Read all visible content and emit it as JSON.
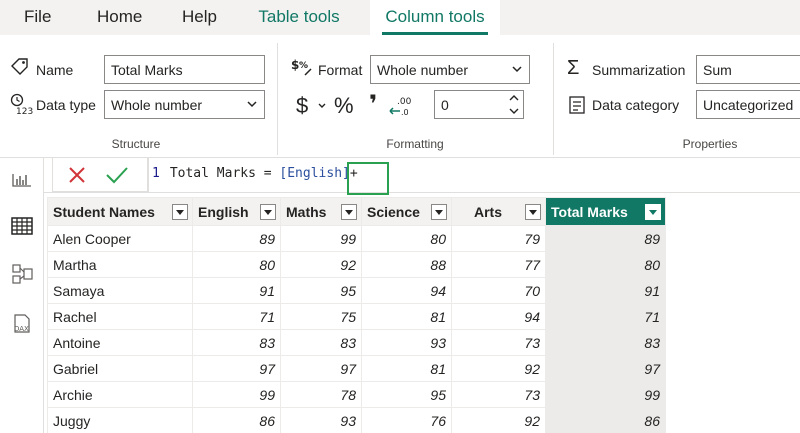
{
  "menu": {
    "tabs": [
      {
        "label": "File"
      },
      {
        "label": "Home"
      },
      {
        "label": "Help"
      },
      {
        "label": "Table tools"
      },
      {
        "label": "Column tools"
      }
    ],
    "accent": "#117865"
  },
  "ribbon": {
    "structure": {
      "name_label": "Name",
      "name_value": "Total Marks",
      "datatype_label": "Data type",
      "datatype_value": "Whole number",
      "title": "Structure"
    },
    "formatting": {
      "format_label": "Format",
      "format_value": "Whole number",
      "currency_symbol": "$",
      "percent_symbol": "%",
      "comma_symbol": "❜",
      "decimals_value": "0",
      "title": "Formatting"
    },
    "properties": {
      "summarization_label": "Summarization",
      "summarization_value": "Sum",
      "category_label": "Data category",
      "category_value": "Uncategorized",
      "title": "Properties"
    }
  },
  "formula": {
    "line_number": "1",
    "prefix": "Total Marks = ",
    "column_ref": "[English]",
    "suffix": "+"
  },
  "table": {
    "columns": [
      "Student Names",
      "English",
      "Maths",
      "Science",
      "Arts",
      "Total Marks"
    ],
    "rows": [
      [
        "Alen Cooper",
        "89",
        "99",
        "80",
        "79",
        "89"
      ],
      [
        "Martha",
        "80",
        "92",
        "88",
        "77",
        "80"
      ],
      [
        "Samaya",
        "91",
        "95",
        "94",
        "70",
        "91"
      ],
      [
        "Rachel",
        "71",
        "75",
        "81",
        "94",
        "71"
      ],
      [
        "Antoine",
        "83",
        "83",
        "93",
        "73",
        "83"
      ],
      [
        "Gabriel",
        "97",
        "97",
        "81",
        "92",
        "97"
      ],
      [
        "Archie",
        "99",
        "78",
        "95",
        "73",
        "99"
      ],
      [
        "Juggy",
        "86",
        "93",
        "76",
        "92",
        "86"
      ]
    ]
  }
}
